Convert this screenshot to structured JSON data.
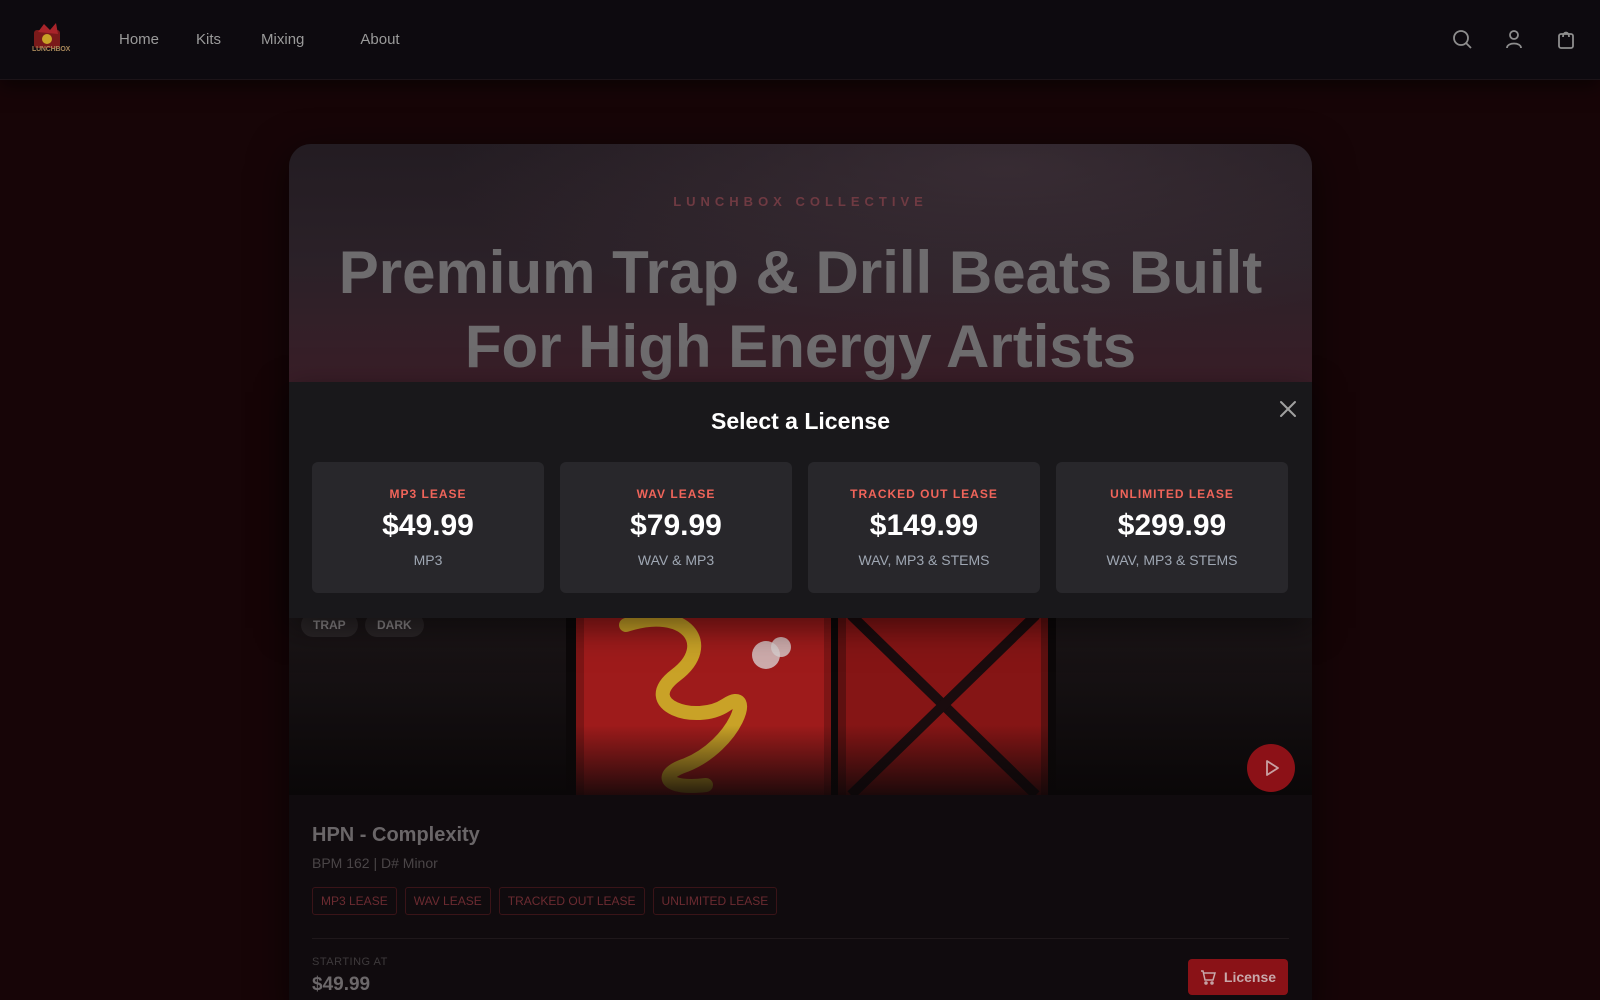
{
  "nav": {
    "logo_text": "LUNCHBOX",
    "links": [
      "Home",
      "Kits",
      "Mixing",
      "About"
    ],
    "icons": [
      "search-icon",
      "user-icon",
      "cart-icon"
    ]
  },
  "hero": {
    "eyebrow": "LUNCHBOX COLLECTIVE",
    "title_line1": "Premium Trap & Drill Beats Built",
    "title_line2": "For High Energy Artists"
  },
  "modal": {
    "title": "Select a License",
    "licenses": [
      {
        "name": "MP3 LEASE",
        "price": "$49.99",
        "format": "MP3"
      },
      {
        "name": "WAV LEASE",
        "price": "$79.99",
        "format": "WAV & MP3"
      },
      {
        "name": "TRACKED OUT LEASE",
        "price": "$149.99",
        "format": "WAV, MP3 & STEMS"
      },
      {
        "name": "UNLIMITED LEASE",
        "price": "$299.99",
        "format": "WAV, MP3 & STEMS"
      }
    ]
  },
  "beat": {
    "tags": [
      "TRAP",
      "DARK"
    ],
    "title": "HPN - Complexity",
    "meta": "BPM 162 | D# Minor",
    "license_tags": [
      "MP3 LEASE",
      "WAV LEASE",
      "TRACKED OUT LEASE",
      "UNLIMITED LEASE"
    ],
    "starting_label": "STARTING AT",
    "starting_price": "$49.99",
    "license_button": "License"
  },
  "colors": {
    "accent": "#f0645a",
    "brand_red": "#8a1217",
    "background": "#170507"
  }
}
